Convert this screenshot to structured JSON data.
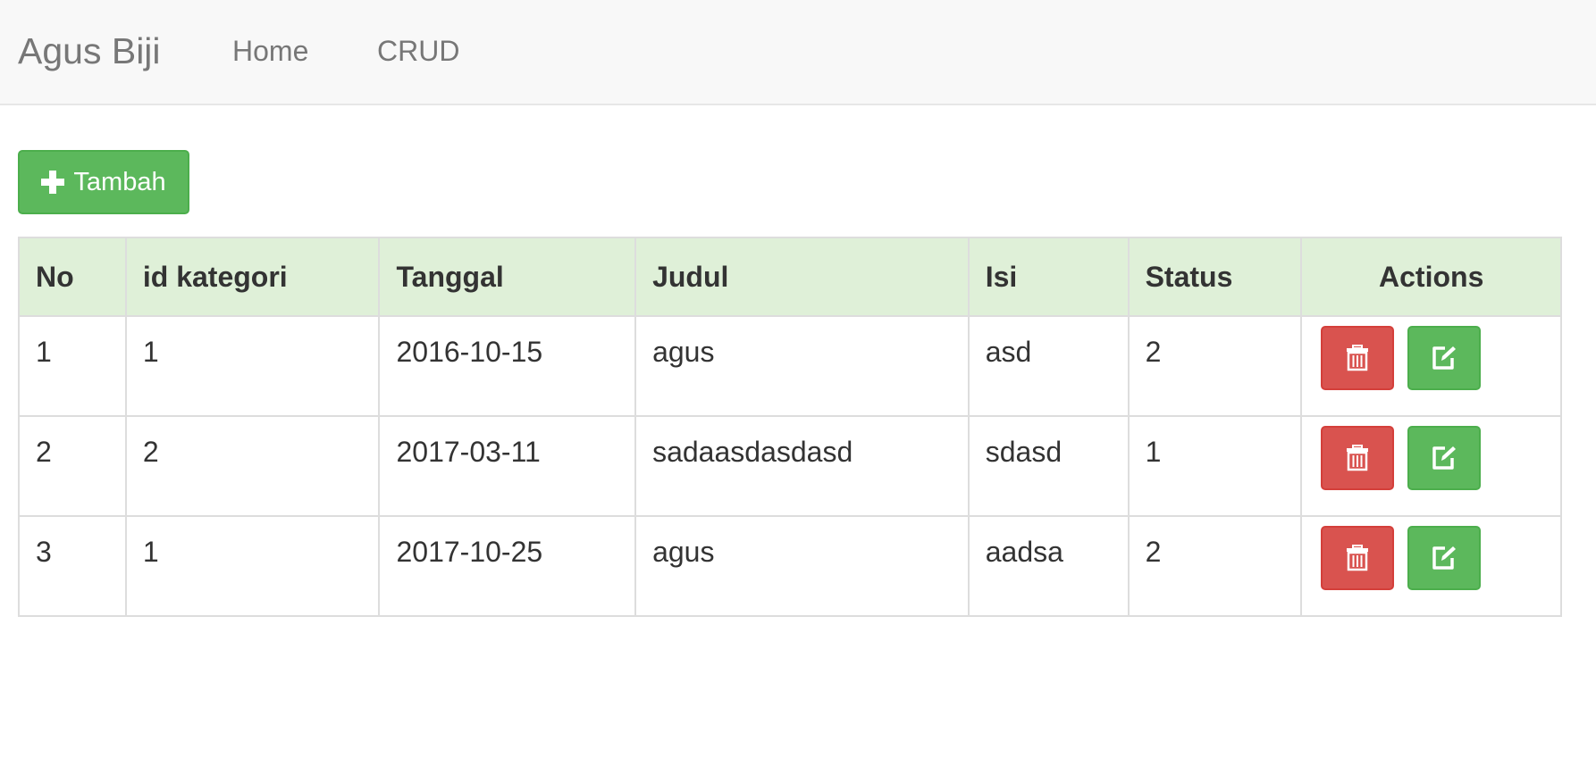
{
  "navbar": {
    "brand": "Agus Biji",
    "links": [
      {
        "label": "Home"
      },
      {
        "label": "CRUD"
      }
    ]
  },
  "add_button": {
    "icon": "plus-icon",
    "label": "Tambah",
    "color": "#5cb85c"
  },
  "table": {
    "headers": {
      "no": "No",
      "id_kategori": "id kategori",
      "tanggal": "Tanggal",
      "judul": "Judul",
      "isi": "Isi",
      "status": "Status",
      "actions": "Actions"
    },
    "header_bg": "#dff0d8",
    "rows": [
      {
        "no": "1",
        "id_kategori": "1",
        "tanggal": "2016-10-15",
        "judul": "agus",
        "isi": "asd",
        "status": "2"
      },
      {
        "no": "2",
        "id_kategori": "2",
        "tanggal": "2017-03-11",
        "judul": "sadaasdasdasd",
        "isi": "sdasd",
        "status": "1"
      },
      {
        "no": "3",
        "id_kategori": "1",
        "tanggal": "2017-10-25",
        "judul": "agus",
        "isi": "aadsa",
        "status": "2"
      }
    ],
    "row_actions": {
      "delete_icon": "trash-icon",
      "delete_color": "#d9534f",
      "edit_icon": "edit-icon",
      "edit_color": "#5cb85c"
    }
  }
}
